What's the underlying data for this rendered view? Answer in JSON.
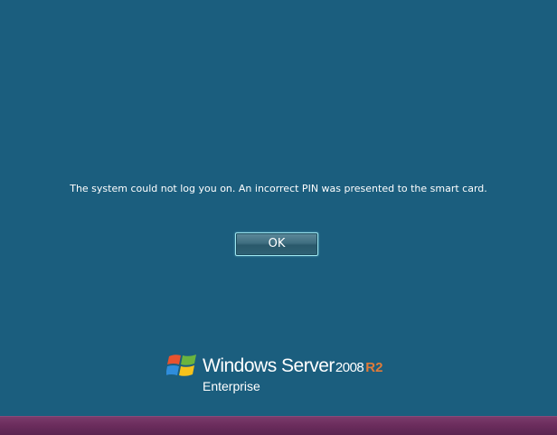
{
  "dialog": {
    "message": "The system could not log you on.  An incorrect PIN was presented to the smart card.",
    "ok_label": "OK"
  },
  "branding": {
    "product": "Windows Server",
    "version": "2008",
    "release": "R2",
    "edition": "Enterprise",
    "logo_icon": "windows-flag-icon"
  },
  "colors": {
    "background": "#1b5e7e",
    "button_border": "#9fe6ef",
    "r2_accent": "#e07b39",
    "bottom_bar": "#6a2c5c"
  }
}
